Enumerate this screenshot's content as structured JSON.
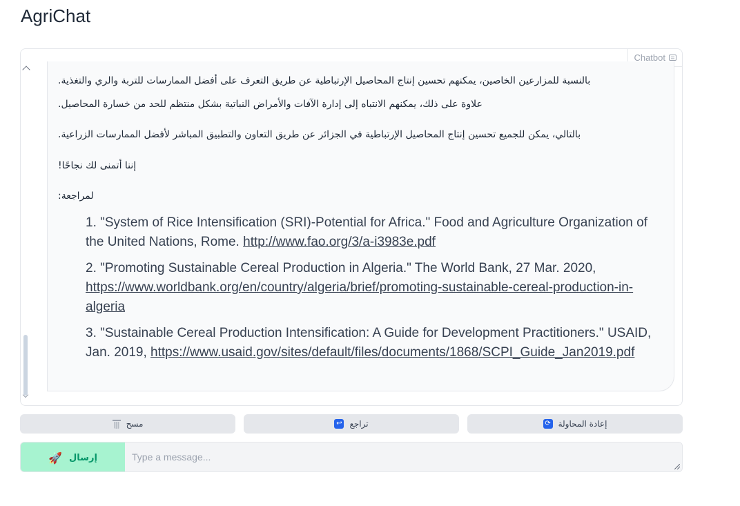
{
  "app": {
    "title": "AgriChat"
  },
  "chatbot": {
    "label": "Chatbot",
    "message": {
      "paragraphs": [
        "بالنسبة للمزارعين الخاصين، يمكنهم تحسين إنتاج المحاصيل الإرتباطية عن طريق التعرف على أفضل الممارسات للتربة والري والتغذية.",
        "علاوة على ذلك، يمكنهم الانتباه إلى إدارة الآفات والأمراض النباتية بشكل منتظم للحد من خسارة المحاصيل.",
        "بالتالي، يمكن للجميع تحسين إنتاج المحاصيل الإرتباطية في الجزائر عن طريق التعاون والتطبيق المباشر لأفضل الممارسات الزراعية.",
        "إننا أتمنى لك نجاحًا!",
        "لمراجعة:"
      ],
      "references": [
        {
          "text": "1. \"System of Rice Intensification (SRI)-Potential for Africa.\" Food and Agriculture Organization of the United Nations, Rome. ",
          "link": "http://www.fao.org/3/a-i3983e.pdf"
        },
        {
          "text": "2. \"Promoting Sustainable Cereal Production in Algeria.\" The World Bank, 27 Mar. 2020, ",
          "link": "https://www.worldbank.org/en/country/algeria/brief/promoting-sustainable-cereal-production-in-algeria"
        },
        {
          "text": "3. \"Sustainable Cereal Production Intensification: A Guide for Development Practitioners.\" USAID, Jan. 2019, ",
          "link": "https://www.usaid.gov/sites/default/files/documents/1868/SCPI_Guide_Jan2019.pdf"
        }
      ]
    }
  },
  "actions": {
    "clear_label": "مسح",
    "undo_label": "تراجع",
    "retry_label": "إعادة المحاولة"
  },
  "composer": {
    "send_label": "إرسال",
    "placeholder": "Type a message..."
  },
  "colors": {
    "send_bg": "#a7f3d0",
    "send_text": "#059669",
    "icon_blue": "#2563eb"
  }
}
